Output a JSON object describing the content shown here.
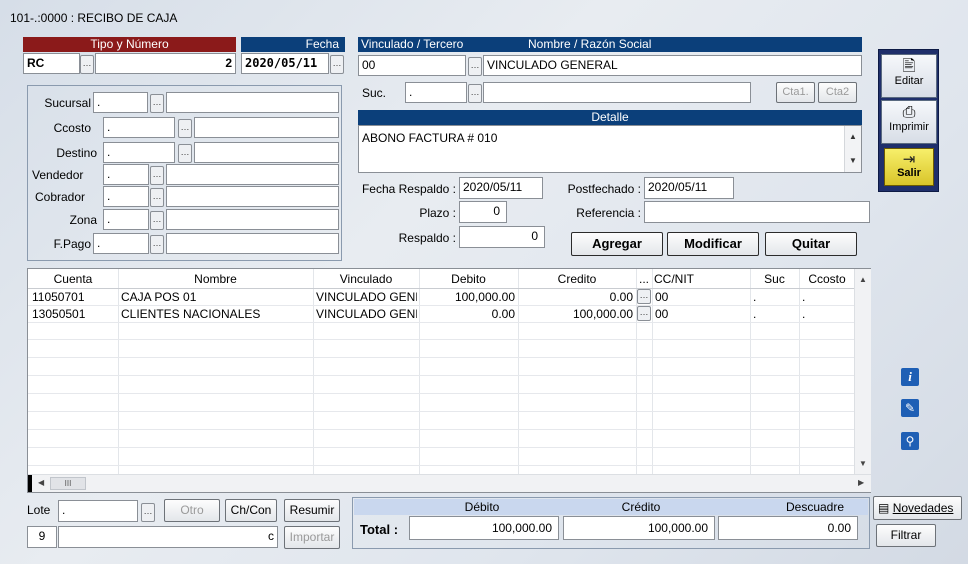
{
  "window": {
    "title": "101-.:0000 : RECIBO DE CAJA"
  },
  "tipo": {
    "header": "Tipo y Número",
    "code": "RC",
    "number": "2"
  },
  "fecha": {
    "header": "Fecha",
    "value": "2020/05/11"
  },
  "tercero": {
    "header_left": "Vinculado / Tercero",
    "header_right": "Nombre / Razón Social",
    "code": "00",
    "name": "VINCULADO GENERAL",
    "suc_label": "Suc.",
    "suc_value": ".",
    "cta1": "Cta1.",
    "cta2": "Cta2"
  },
  "detalle": {
    "header": "Detalle",
    "text": "ABONO FACTURA # 010"
  },
  "left_fields": [
    {
      "label": "Sucursal",
      "value": "."
    },
    {
      "label": "Ccosto",
      "value": "."
    },
    {
      "label": "Destino",
      "value": "."
    },
    {
      "label": "Vendedor",
      "value": "."
    },
    {
      "label": "Cobrador",
      "value": "."
    },
    {
      "label": "Zona",
      "value": "."
    },
    {
      "label": "F.Pago",
      "value": "."
    }
  ],
  "extra": {
    "fecha_respaldo_label": "Fecha Respaldo :",
    "fecha_respaldo": "2020/05/11",
    "postfechado_label": "Postfechado :",
    "postfechado": "2020/05/11",
    "plazo_label": "Plazo :",
    "plazo": "0",
    "referencia_label": "Referencia :",
    "referencia": "",
    "respaldo_label": "Respaldo :",
    "respaldo": "0"
  },
  "actions": {
    "agregar": "Agregar",
    "modificar": "Modificar",
    "quitar": "Quitar"
  },
  "side": {
    "editar": "Editar",
    "imprimir": "Imprimir",
    "salir": "Salir",
    "novedades": "Novedades",
    "filtrar": "Filtrar"
  },
  "grid": {
    "columns": [
      "Cuenta",
      "Nombre",
      "Vinculado",
      "Debito",
      "Credito",
      "...",
      "CC/NIT",
      "Suc",
      "Ccosto"
    ],
    "rows": [
      {
        "cuenta": "11050701",
        "nombre": "CAJA POS 01",
        "vinculado": "VINCULADO GENE",
        "debito": "100,000.00",
        "credito": "0.00",
        "ccnit": "00",
        "suc": ".",
        "ccosto": "."
      },
      {
        "cuenta": "13050501",
        "nombre": "CLIENTES NACIONALES",
        "vinculado": "VINCULADO GENE",
        "debito": "0.00",
        "credito": "100,000.00",
        "ccnit": "00",
        "suc": ".",
        "ccosto": "."
      }
    ],
    "hscroll_thumb": "III"
  },
  "lote": {
    "label": "Lote",
    "value": ".",
    "number": "9",
    "c": "c",
    "otro": "Otro",
    "chcon": "Ch/Con",
    "resumir": "Resumir",
    "importar": "Importar"
  },
  "totals": {
    "total_label": "Total :",
    "debito_label": "Débito",
    "credito_label": "Crédito",
    "descuadre_label": "Descuadre",
    "debito": "100,000.00",
    "credito": "100,000.00",
    "descuadre": "0.00"
  }
}
